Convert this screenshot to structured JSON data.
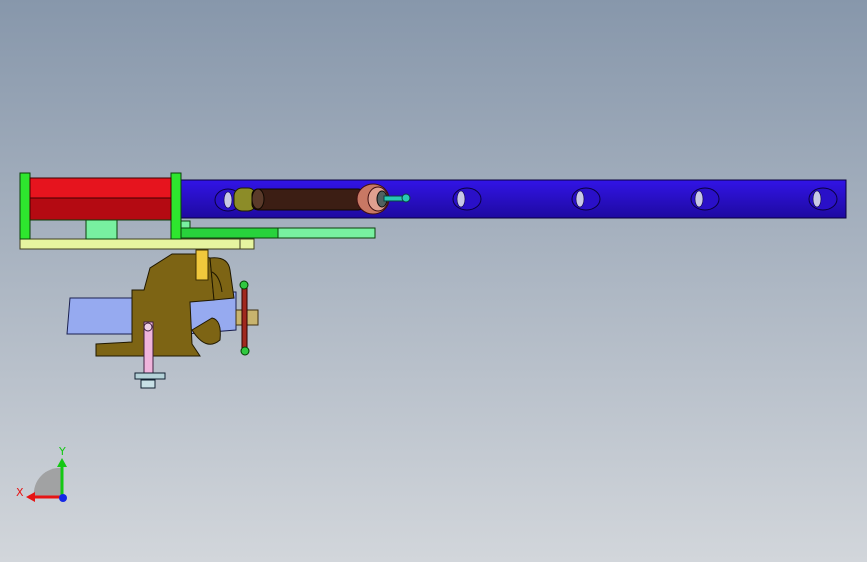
{
  "viewport": {
    "background_top": "#8797ab",
    "background_bottom": "#d2d6db"
  },
  "model": {
    "colors": {
      "frame_green": "#2ee62e",
      "plate_red": "#e6141e",
      "plate_dark_red": "#b40a12",
      "tube_blue": "#3214e6",
      "tube_blue_dark": "#1e0aa0",
      "rail_pale": "#e6f5a0",
      "rail_green": "#28d23c",
      "rail_light_green": "#78f0a0",
      "vise_body": "#7d6414",
      "vise_jaw": "#96aaf0",
      "vise_handle": "#a0281e",
      "shaft_dark": "#3c1e14",
      "bolt_pink": "#f0b4dc",
      "clamp_yellow": "#f0c83c",
      "pin_cyan": "#28c8b4"
    }
  },
  "triad": {
    "x_label": "X",
    "y_label": "Y",
    "x_color": "#e61414",
    "y_color": "#14c814",
    "z_color": "#1428e6"
  }
}
